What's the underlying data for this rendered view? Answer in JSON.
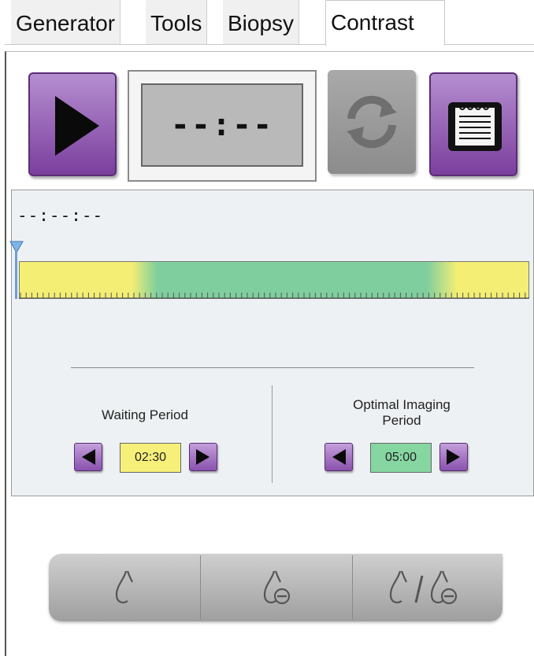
{
  "tabs": [
    {
      "label": "Generator",
      "active": false
    },
    {
      "label": "Tools",
      "active": false
    },
    {
      "label": "Biopsy",
      "active": false
    },
    {
      "label": "Contrast",
      "active": true
    }
  ],
  "timer": {
    "display": "--:--"
  },
  "timeline": {
    "elapsed_readout": "--:--:--",
    "colors": {
      "waiting": "#f4ee74",
      "optimal": "#7fcf9e"
    }
  },
  "waiting_period": {
    "label": "Waiting Period",
    "value": "02:30",
    "color": "#f6f07a"
  },
  "optimal_period": {
    "label_line1": "Optimal Imaging",
    "label_line2": "Period",
    "value": "05:00",
    "color": "#86d6a2"
  },
  "icons": {
    "start": "play-icon",
    "reset": "refresh-icon",
    "notes": "notepad-icon",
    "cursor": "timeline-cursor-icon"
  },
  "accent_colors": {
    "purple": "#8a52ad",
    "gray": "#9c9c9c"
  },
  "bottom_modes": [
    {
      "name": "view-mode-a",
      "icon": "breast-outline-icon"
    },
    {
      "name": "view-mode-b",
      "icon": "breast-minus-icon"
    },
    {
      "name": "view-mode-c",
      "icon": "breast-outline-and-minus-icon"
    }
  ]
}
